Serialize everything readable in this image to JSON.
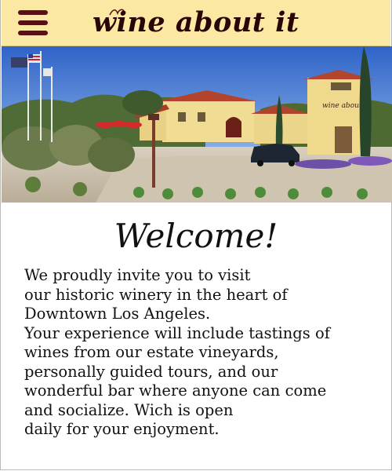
{
  "header": {
    "menu_icon": "hamburger-menu-icon",
    "brand_text": "wine about it",
    "background": "#fbe9a3",
    "brand_color": "#5a0f18"
  },
  "hero": {
    "sign_text": "wine about it"
  },
  "welcome": {
    "heading": "Welcome!",
    "lines": [
      "We proudly invite you to visit",
      "our historic winery in the heart of",
      "Downtown Los Angeles.",
      "Your experience will include tastings of",
      "wines from our estate vineyards,",
      "personally guided tours, and our",
      "wonderful bar where anyone can come",
      "and socialize. Wich is open",
      "daily for your enjoyment."
    ]
  }
}
